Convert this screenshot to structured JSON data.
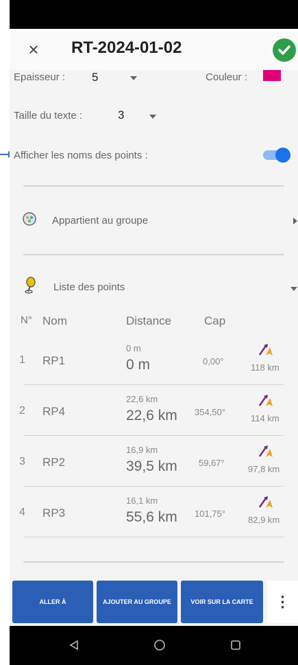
{
  "header": {
    "title": "RT-2024-01-02",
    "close_icon": "×"
  },
  "settings": {
    "epaisseur_label": "Epaisseur :",
    "epaisseur_value": "5",
    "couleur_label": "Couleur :",
    "couleur_color": "#e0007a",
    "taille_label": "Taille du texte :",
    "taille_value": "3",
    "afficher_label": "Afficher les noms des points :",
    "afficher_on": true
  },
  "group": {
    "label": "Appartient au groupe"
  },
  "points": {
    "label": "Liste des points",
    "columns": [
      "N°",
      "Nom",
      "Distance",
      "Cap"
    ],
    "rows": [
      {
        "n": "1",
        "name": "RP1",
        "dist_small": "0 m",
        "dist_large": "0 m",
        "cap": "0,00°",
        "km": "118 km"
      },
      {
        "n": "2",
        "name": "RP4",
        "dist_small": "22,6 km",
        "dist_large": "22,6 km",
        "cap": "354,50°",
        "km": "114 km"
      },
      {
        "n": "3",
        "name": "RP2",
        "dist_small": "16,9 km",
        "dist_large": "39,5 km",
        "cap": "59,67°",
        "km": "97,8 km"
      },
      {
        "n": "4",
        "name": "RP3",
        "dist_small": "16,1 km",
        "dist_large": "55,6 km",
        "cap": "101,75°",
        "km": "82,9 km"
      }
    ]
  },
  "actions": {
    "aller": "ALLER À",
    "ajouter": "AJOUTER AU GROUPE",
    "voir": "VOIR SUR LA CARTE",
    "more_icon": "⋮"
  },
  "colors": {
    "accent": "#2b5fb5",
    "check": "#2e9e4a",
    "toggle": "#1a73e8"
  }
}
